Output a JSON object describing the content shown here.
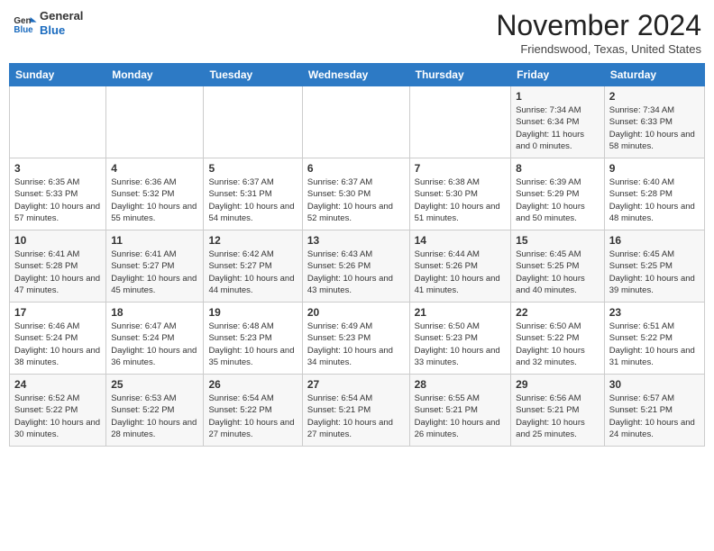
{
  "header": {
    "logo_general": "General",
    "logo_blue": "Blue",
    "title": "November 2024",
    "subtitle": "Friendswood, Texas, United States"
  },
  "weekdays": [
    "Sunday",
    "Monday",
    "Tuesday",
    "Wednesday",
    "Thursday",
    "Friday",
    "Saturday"
  ],
  "weeks": [
    [
      {
        "day": "",
        "info": ""
      },
      {
        "day": "",
        "info": ""
      },
      {
        "day": "",
        "info": ""
      },
      {
        "day": "",
        "info": ""
      },
      {
        "day": "",
        "info": ""
      },
      {
        "day": "1",
        "info": "Sunrise: 7:34 AM\nSunset: 6:34 PM\nDaylight: 11 hours and 0 minutes."
      },
      {
        "day": "2",
        "info": "Sunrise: 7:34 AM\nSunset: 6:33 PM\nDaylight: 10 hours and 58 minutes."
      }
    ],
    [
      {
        "day": "3",
        "info": "Sunrise: 6:35 AM\nSunset: 5:33 PM\nDaylight: 10 hours and 57 minutes."
      },
      {
        "day": "4",
        "info": "Sunrise: 6:36 AM\nSunset: 5:32 PM\nDaylight: 10 hours and 55 minutes."
      },
      {
        "day": "5",
        "info": "Sunrise: 6:37 AM\nSunset: 5:31 PM\nDaylight: 10 hours and 54 minutes."
      },
      {
        "day": "6",
        "info": "Sunrise: 6:37 AM\nSunset: 5:30 PM\nDaylight: 10 hours and 52 minutes."
      },
      {
        "day": "7",
        "info": "Sunrise: 6:38 AM\nSunset: 5:30 PM\nDaylight: 10 hours and 51 minutes."
      },
      {
        "day": "8",
        "info": "Sunrise: 6:39 AM\nSunset: 5:29 PM\nDaylight: 10 hours and 50 minutes."
      },
      {
        "day": "9",
        "info": "Sunrise: 6:40 AM\nSunset: 5:28 PM\nDaylight: 10 hours and 48 minutes."
      }
    ],
    [
      {
        "day": "10",
        "info": "Sunrise: 6:41 AM\nSunset: 5:28 PM\nDaylight: 10 hours and 47 minutes."
      },
      {
        "day": "11",
        "info": "Sunrise: 6:41 AM\nSunset: 5:27 PM\nDaylight: 10 hours and 45 minutes."
      },
      {
        "day": "12",
        "info": "Sunrise: 6:42 AM\nSunset: 5:27 PM\nDaylight: 10 hours and 44 minutes."
      },
      {
        "day": "13",
        "info": "Sunrise: 6:43 AM\nSunset: 5:26 PM\nDaylight: 10 hours and 43 minutes."
      },
      {
        "day": "14",
        "info": "Sunrise: 6:44 AM\nSunset: 5:26 PM\nDaylight: 10 hours and 41 minutes."
      },
      {
        "day": "15",
        "info": "Sunrise: 6:45 AM\nSunset: 5:25 PM\nDaylight: 10 hours and 40 minutes."
      },
      {
        "day": "16",
        "info": "Sunrise: 6:45 AM\nSunset: 5:25 PM\nDaylight: 10 hours and 39 minutes."
      }
    ],
    [
      {
        "day": "17",
        "info": "Sunrise: 6:46 AM\nSunset: 5:24 PM\nDaylight: 10 hours and 38 minutes."
      },
      {
        "day": "18",
        "info": "Sunrise: 6:47 AM\nSunset: 5:24 PM\nDaylight: 10 hours and 36 minutes."
      },
      {
        "day": "19",
        "info": "Sunrise: 6:48 AM\nSunset: 5:23 PM\nDaylight: 10 hours and 35 minutes."
      },
      {
        "day": "20",
        "info": "Sunrise: 6:49 AM\nSunset: 5:23 PM\nDaylight: 10 hours and 34 minutes."
      },
      {
        "day": "21",
        "info": "Sunrise: 6:50 AM\nSunset: 5:23 PM\nDaylight: 10 hours and 33 minutes."
      },
      {
        "day": "22",
        "info": "Sunrise: 6:50 AM\nSunset: 5:22 PM\nDaylight: 10 hours and 32 minutes."
      },
      {
        "day": "23",
        "info": "Sunrise: 6:51 AM\nSunset: 5:22 PM\nDaylight: 10 hours and 31 minutes."
      }
    ],
    [
      {
        "day": "24",
        "info": "Sunrise: 6:52 AM\nSunset: 5:22 PM\nDaylight: 10 hours and 30 minutes."
      },
      {
        "day": "25",
        "info": "Sunrise: 6:53 AM\nSunset: 5:22 PM\nDaylight: 10 hours and 28 minutes."
      },
      {
        "day": "26",
        "info": "Sunrise: 6:54 AM\nSunset: 5:22 PM\nDaylight: 10 hours and 27 minutes."
      },
      {
        "day": "27",
        "info": "Sunrise: 6:54 AM\nSunset: 5:21 PM\nDaylight: 10 hours and 27 minutes."
      },
      {
        "day": "28",
        "info": "Sunrise: 6:55 AM\nSunset: 5:21 PM\nDaylight: 10 hours and 26 minutes."
      },
      {
        "day": "29",
        "info": "Sunrise: 6:56 AM\nSunset: 5:21 PM\nDaylight: 10 hours and 25 minutes."
      },
      {
        "day": "30",
        "info": "Sunrise: 6:57 AM\nSunset: 5:21 PM\nDaylight: 10 hours and 24 minutes."
      }
    ]
  ]
}
